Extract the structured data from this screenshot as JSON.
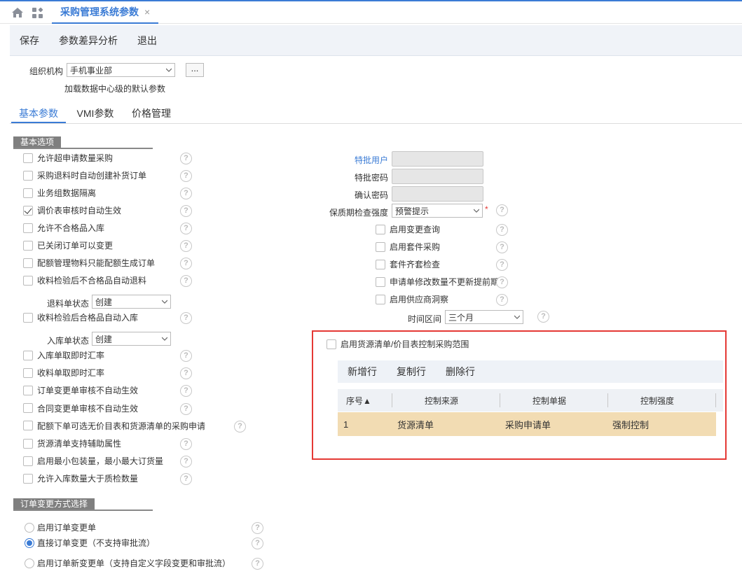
{
  "top_tab": {
    "title": "采购管理系统参数",
    "close": "×"
  },
  "toolbar": {
    "save": "保存",
    "diff": "参数差异分析",
    "exit": "退出"
  },
  "org": {
    "label": "组织机构",
    "value": "手机事业部",
    "more": "...",
    "hint": "加载数据中心级的默认参数"
  },
  "subtabs": [
    "基本参数",
    "VMI参数",
    "价格管理"
  ],
  "section1": {
    "title": "基本选项"
  },
  "left_options": [
    {
      "label": "允许超申请数量采购",
      "checked": false
    },
    {
      "label": "采购退料时自动创建补货订单",
      "checked": false
    },
    {
      "label": "业务组数据隔离",
      "checked": false
    },
    {
      "label": "调价表审核时自动生效",
      "checked": true
    },
    {
      "label": "允许不合格品入库",
      "checked": false
    },
    {
      "label": "已关闭订单可以变更",
      "checked": false
    },
    {
      "label": "配额管理物料只能配额生成订单",
      "checked": false
    },
    {
      "label": "收料检验后不合格品自动退料",
      "checked": false
    }
  ],
  "return_state": {
    "label": "退料单状态",
    "value": "创建"
  },
  "left_options2": [
    {
      "label": "收料检验后合格品自动入库",
      "checked": false
    }
  ],
  "instock_state": {
    "label": "入库单状态",
    "value": "创建"
  },
  "left_options3": [
    {
      "label": "入库单取即时汇率",
      "checked": false
    },
    {
      "label": "收料单取即时汇率",
      "checked": false
    },
    {
      "label": "订单变更单审核不自动生效",
      "checked": false
    },
    {
      "label": "合同变更单审核不自动生效",
      "checked": false
    },
    {
      "label": "配额下单可选无价目表和货源清单的采购申请",
      "checked": false
    },
    {
      "label": "货源清单支持辅助属性",
      "checked": false
    },
    {
      "label": "启用最小包装量，最小最大订货量",
      "checked": false
    },
    {
      "label": "允许入库数量大于质检数量",
      "checked": false
    }
  ],
  "section2": {
    "title": "订单变更方式选择"
  },
  "radios": [
    {
      "label": "启用订单变更单",
      "on": false
    },
    {
      "label": "直接订单变更（不支持审批流）",
      "on": true
    },
    {
      "label": "启用订单新变更单（支持自定义字段变更和审批流）",
      "on": false
    }
  ],
  "right": {
    "special_user": "特批用户",
    "special_pwd": "特批密码",
    "confirm_pwd": "确认密码",
    "shelf_check": "保质期检查强度",
    "shelf_value": "预警提示",
    "required": "*",
    "options": [
      {
        "label": "启用变更查询",
        "checked": false
      },
      {
        "label": "启用套件采购",
        "checked": false
      },
      {
        "label": "套件齐套检查",
        "checked": false
      },
      {
        "label": "申请单修改数量不更新提前期",
        "checked": false
      },
      {
        "label": "启用供应商洞察",
        "checked": false
      }
    ],
    "time_range": "时间区间",
    "time_value": "三个月"
  },
  "source_box": {
    "label": "启用货源清单/价目表控制采购范围",
    "buttons": [
      "新增行",
      "复制行",
      "删除行"
    ],
    "columns": [
      "序号▲",
      "控制来源",
      "控制单据",
      "控制强度"
    ],
    "rows": [
      [
        "1",
        "货源清单",
        "采购申请单",
        "强制控制"
      ]
    ]
  },
  "colors": {
    "accent": "#3a7bd5",
    "highlight_row": "#f2dcb3",
    "red_box": "#e53935"
  }
}
